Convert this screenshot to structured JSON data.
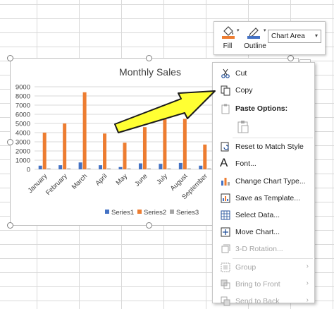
{
  "colors": {
    "series1": "#4472c4",
    "series2": "#ed7d31",
    "series3": "#a5a5a5",
    "arrow_fill": "#ffff33",
    "arrow_stroke": "#1a1a1a"
  },
  "chart_data": {
    "type": "bar",
    "title": "Monthly Sales",
    "categories": [
      "January",
      "February",
      "March",
      "April",
      "May",
      "June",
      "July",
      "August",
      "September"
    ],
    "series": [
      {
        "name": "Series1",
        "values": [
          400,
          450,
          750,
          450,
          250,
          650,
          600,
          700,
          400
        ]
      },
      {
        "name": "Series2",
        "values": [
          4000,
          5000,
          8400,
          3900,
          2900,
          4600,
          6300,
          5500,
          2700
        ]
      },
      {
        "name": "Series3",
        "values": [
          100,
          100,
          100,
          100,
          100,
          100,
          100,
          100,
          100
        ]
      }
    ],
    "ylim": [
      0,
      9000
    ],
    "yticks": [
      "0",
      "1000",
      "2000",
      "3000",
      "4000",
      "5000",
      "6000",
      "7000",
      "8000",
      "9000"
    ],
    "grid": true,
    "legend_position": "bottom"
  },
  "toolbar": {
    "fill_label": "Fill",
    "outline_label": "Outline",
    "element_select_value": "Chart Area",
    "fill_icon": "paint-bucket-icon",
    "outline_icon": "pen-outline-icon"
  },
  "context_menu": {
    "cut": "Cut",
    "copy": "Copy",
    "paste_options": "Paste Options:",
    "reset_style": "Reset to Match Style",
    "font": "Font...",
    "change_type": "Change Chart Type...",
    "save_template": "Save as Template...",
    "select_data": "Select Data...",
    "move_chart": "Move Chart...",
    "rotation": "3-D Rotation...",
    "group": "Group",
    "bring_front": "Bring to Front",
    "send_back": "Send to Back"
  }
}
